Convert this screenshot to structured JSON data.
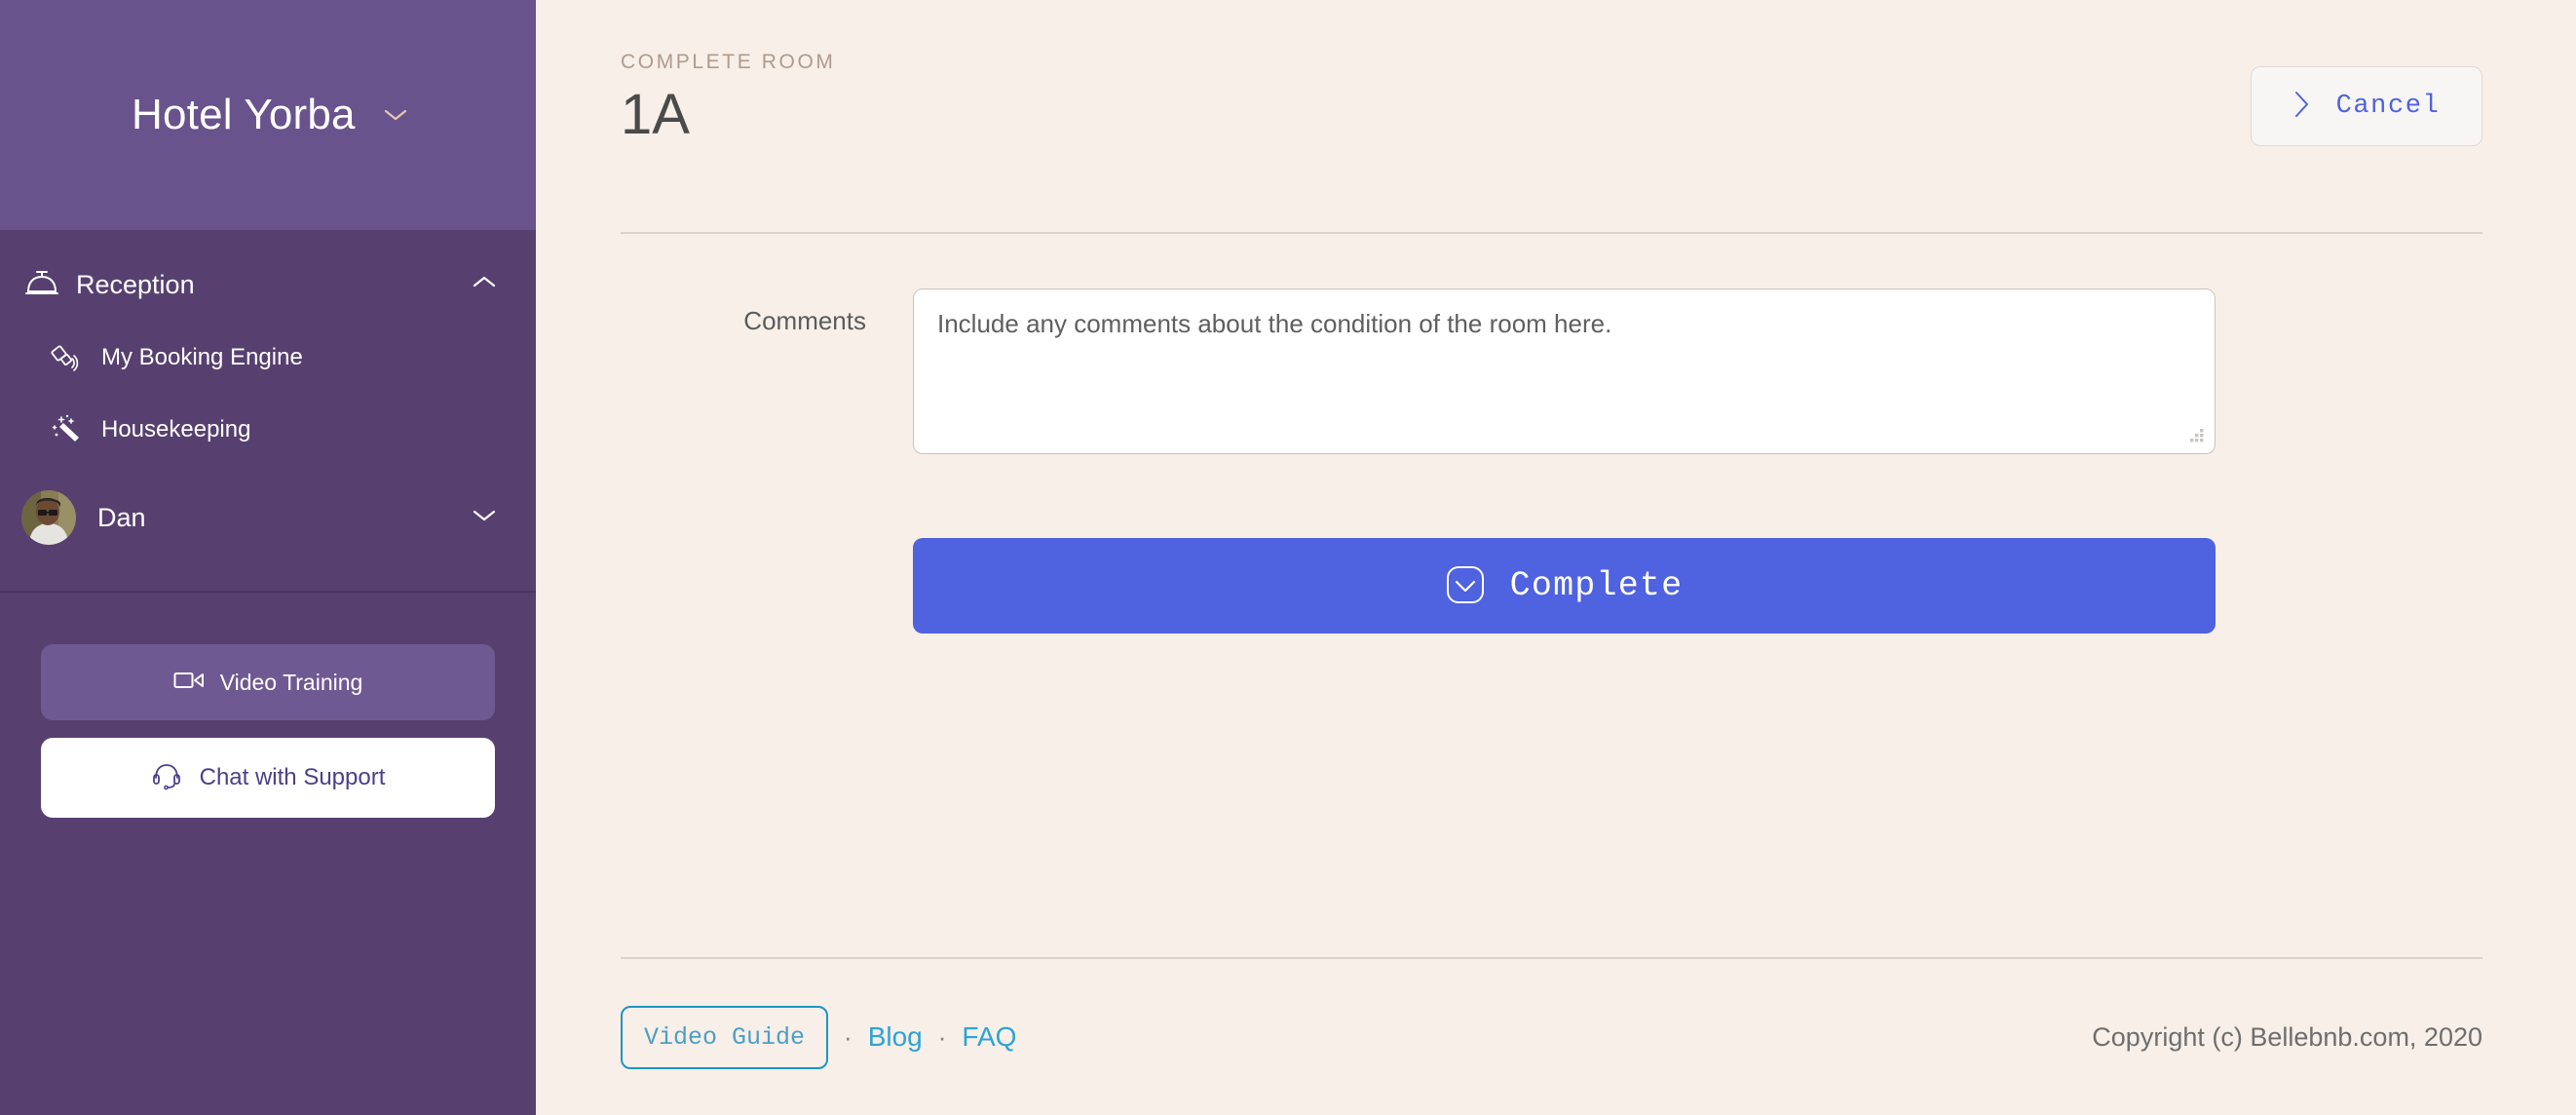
{
  "brand": {
    "name": "Hotel Yorba",
    "chevron_icon": "chevron-down-icon"
  },
  "sidebar": {
    "groups": [
      {
        "label": "Reception",
        "icon": "service-bell-icon",
        "toggle_icon": "chevron-up-icon",
        "expanded": true,
        "items": [
          {
            "label": "My Booking Engine",
            "icon": "satellite-icon"
          },
          {
            "label": "Housekeeping",
            "icon": "magic-wand-icon"
          }
        ]
      }
    ],
    "user": {
      "name": "Dan",
      "avatar_icon": "avatar",
      "toggle_icon": "chevron-down-icon"
    },
    "actions": {
      "video_training": {
        "label": "Video Training",
        "icon": "video-camera-icon"
      },
      "chat_support": {
        "label": "Chat with Support",
        "icon": "headset-icon"
      }
    }
  },
  "header": {
    "eyebrow": "COMPLETE ROOM",
    "title": "1A",
    "cancel": {
      "label": "Cancel",
      "icon": "chevron-right-icon"
    }
  },
  "form": {
    "comments": {
      "label": "Comments",
      "value": "",
      "placeholder": "Include any comments about the condition of the room here."
    },
    "submit": {
      "label": "Complete",
      "icon": "check-square-icon"
    }
  },
  "footer": {
    "video_guide_label": "Video Guide",
    "separator": "·",
    "links": [
      {
        "label": "Blog"
      },
      {
        "label": "FAQ"
      }
    ],
    "copyright": "Copyright (c) Bellebnb.com, 2020"
  },
  "colors": {
    "sidebar_header": "#68538c",
    "sidebar_body": "#57406f",
    "page_background": "#f7efe8",
    "accent_blue": "#4f62e0",
    "link_blue": "#2ba4d8",
    "eyebrow_tan": "#b09b8d"
  }
}
